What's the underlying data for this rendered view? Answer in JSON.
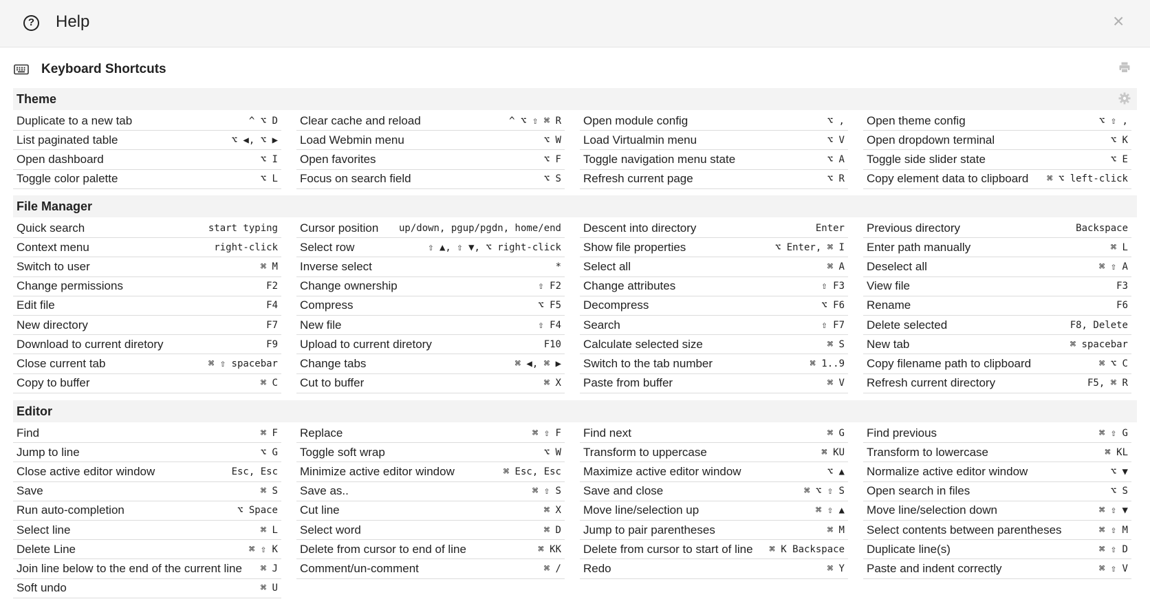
{
  "header": {
    "title": "Help",
    "help_icon": "?",
    "close_icon": "×"
  },
  "shortcuts": {
    "title": "Keyboard Shortcuts"
  },
  "sections": [
    {
      "title": "Theme",
      "columns": [
        [
          [
            "Duplicate to a new tab",
            "^ ⌥ D"
          ],
          [
            "List paginated table",
            "⌥ ◀, ⌥ ▶"
          ],
          [
            "Open dashboard",
            "⌥ I"
          ],
          [
            "Toggle color palette",
            "⌥ L"
          ]
        ],
        [
          [
            "Clear cache and reload",
            "^ ⌥ ⇧ ⌘ R"
          ],
          [
            "Load Webmin menu",
            "⌥ W"
          ],
          [
            "Open favorites",
            "⌥ F"
          ],
          [
            "Focus on search field",
            "⌥ S"
          ]
        ],
        [
          [
            "Open module config",
            "⌥ ,"
          ],
          [
            "Load Virtualmin menu",
            "⌥ V"
          ],
          [
            "Toggle navigation menu state",
            "⌥ A"
          ],
          [
            "Refresh current page",
            "⌥ R"
          ]
        ],
        [
          [
            "Open theme config",
            "⌥ ⇧ ,"
          ],
          [
            "Open dropdown terminal",
            "⌥ K"
          ],
          [
            "Toggle side slider state",
            "⌥ E"
          ],
          [
            "Copy element data to clipboard",
            "⌘ ⌥ left-click"
          ]
        ]
      ]
    },
    {
      "title": "File Manager",
      "columns": [
        [
          [
            "Quick search",
            "start typing"
          ],
          [
            "Context menu",
            "right-click"
          ],
          [
            "Switch to user",
            "⌘ M"
          ],
          [
            "Change permissions",
            "F2"
          ],
          [
            "Edit file",
            "F4"
          ],
          [
            "New directory",
            "F7"
          ],
          [
            "Download to current diretory",
            "F9"
          ],
          [
            "Close current tab",
            "⌘ ⇧ spacebar"
          ],
          [
            "Copy to buffer",
            "⌘ C"
          ]
        ],
        [
          [
            "Cursor position",
            "up/down, pgup/pgdn, home/end"
          ],
          [
            "Select row",
            "⇧ ▲, ⇧ ▼, ⌥ right-click"
          ],
          [
            "Inverse select",
            "*"
          ],
          [
            "Change ownership",
            "⇧ F2"
          ],
          [
            "Compress",
            "⌥ F5"
          ],
          [
            "New file",
            "⇧ F4"
          ],
          [
            "Upload to current diretory",
            "F10"
          ],
          [
            "Change tabs",
            "⌘ ◀, ⌘ ▶"
          ],
          [
            "Cut to buffer",
            "⌘ X"
          ]
        ],
        [
          [
            "Descent into directory",
            "Enter"
          ],
          [
            "Show file properties",
            "⌥ Enter, ⌘ I"
          ],
          [
            "Select all",
            "⌘ A"
          ],
          [
            "Change attributes",
            "⇧ F3"
          ],
          [
            "Decompress",
            "⌥ F6"
          ],
          [
            "Search",
            "⇧ F7"
          ],
          [
            "Calculate selected size",
            "⌘ S"
          ],
          [
            "Switch to the tab number",
            "⌘ 1..9"
          ],
          [
            "Paste from buffer",
            "⌘ V"
          ]
        ],
        [
          [
            "Previous directory",
            "Backspace"
          ],
          [
            "Enter path manually",
            "⌘ L"
          ],
          [
            "Deselect all",
            "⌘ ⇧ A"
          ],
          [
            "View file",
            "F3"
          ],
          [
            "Rename",
            "F6"
          ],
          [
            "Delete selected",
            "F8, Delete"
          ],
          [
            "New tab",
            "⌘ spacebar"
          ],
          [
            "Copy filename path to clipboard",
            "⌘ ⌥ C"
          ],
          [
            "Refresh current directory",
            "F5, ⌘ R"
          ]
        ]
      ]
    },
    {
      "title": "Editor",
      "columns": [
        [
          [
            "Find",
            "⌘ F"
          ],
          [
            "Jump to line",
            "⌥ G"
          ],
          [
            "Close active editor window",
            "Esc, Esc"
          ],
          [
            "Save",
            "⌘ S"
          ],
          [
            "Run auto-completion",
            "⌥ Space"
          ],
          [
            "Select line",
            "⌘ L"
          ],
          [
            "Delete Line",
            "⌘ ⇧ K"
          ],
          [
            "Join line below to the end of the current line",
            "⌘ J"
          ],
          [
            "Soft undo",
            "⌘ U"
          ]
        ],
        [
          [
            "Replace",
            "⌘ ⇧ F"
          ],
          [
            "Toggle soft wrap",
            "⌥ W"
          ],
          [
            "Minimize active editor window",
            "⌘ Esc, Esc"
          ],
          [
            "Save as..",
            "⌘ ⇧ S"
          ],
          [
            "Cut line",
            "⌘ X"
          ],
          [
            "Select word",
            "⌘ D"
          ],
          [
            "Delete from cursor to end of line",
            "⌘ KK"
          ],
          [
            "Comment/un-comment",
            "⌘ /"
          ]
        ],
        [
          [
            "Find next",
            "⌘ G"
          ],
          [
            "Transform to uppercase",
            "⌘ KU"
          ],
          [
            "Maximize active editor window",
            "⌥ ▲"
          ],
          [
            "Save and close",
            "⌘ ⌥ ⇧ S"
          ],
          [
            "Move line/selection up",
            "⌘ ⇧ ▲"
          ],
          [
            "Jump to pair parentheses",
            "⌘ M"
          ],
          [
            "Delete from cursor to start of line",
            "⌘ K Backspace"
          ],
          [
            "Redo",
            "⌘ Y"
          ]
        ],
        [
          [
            "Find previous",
            "⌘ ⇧ G"
          ],
          [
            "Transform to lowercase",
            "⌘ KL"
          ],
          [
            "Normalize active editor window",
            "⌥ ▼"
          ],
          [
            "Open search in files",
            "⌥ S"
          ],
          [
            "Move line/selection down",
            "⌘ ⇧ ▼"
          ],
          [
            "Select contents between parentheses",
            "⌘ ⇧ M"
          ],
          [
            "Duplicate line(s)",
            "⌘ ⇧ D"
          ],
          [
            "Paste and indent correctly",
            "⌘ ⇧ V"
          ]
        ]
      ]
    }
  ]
}
